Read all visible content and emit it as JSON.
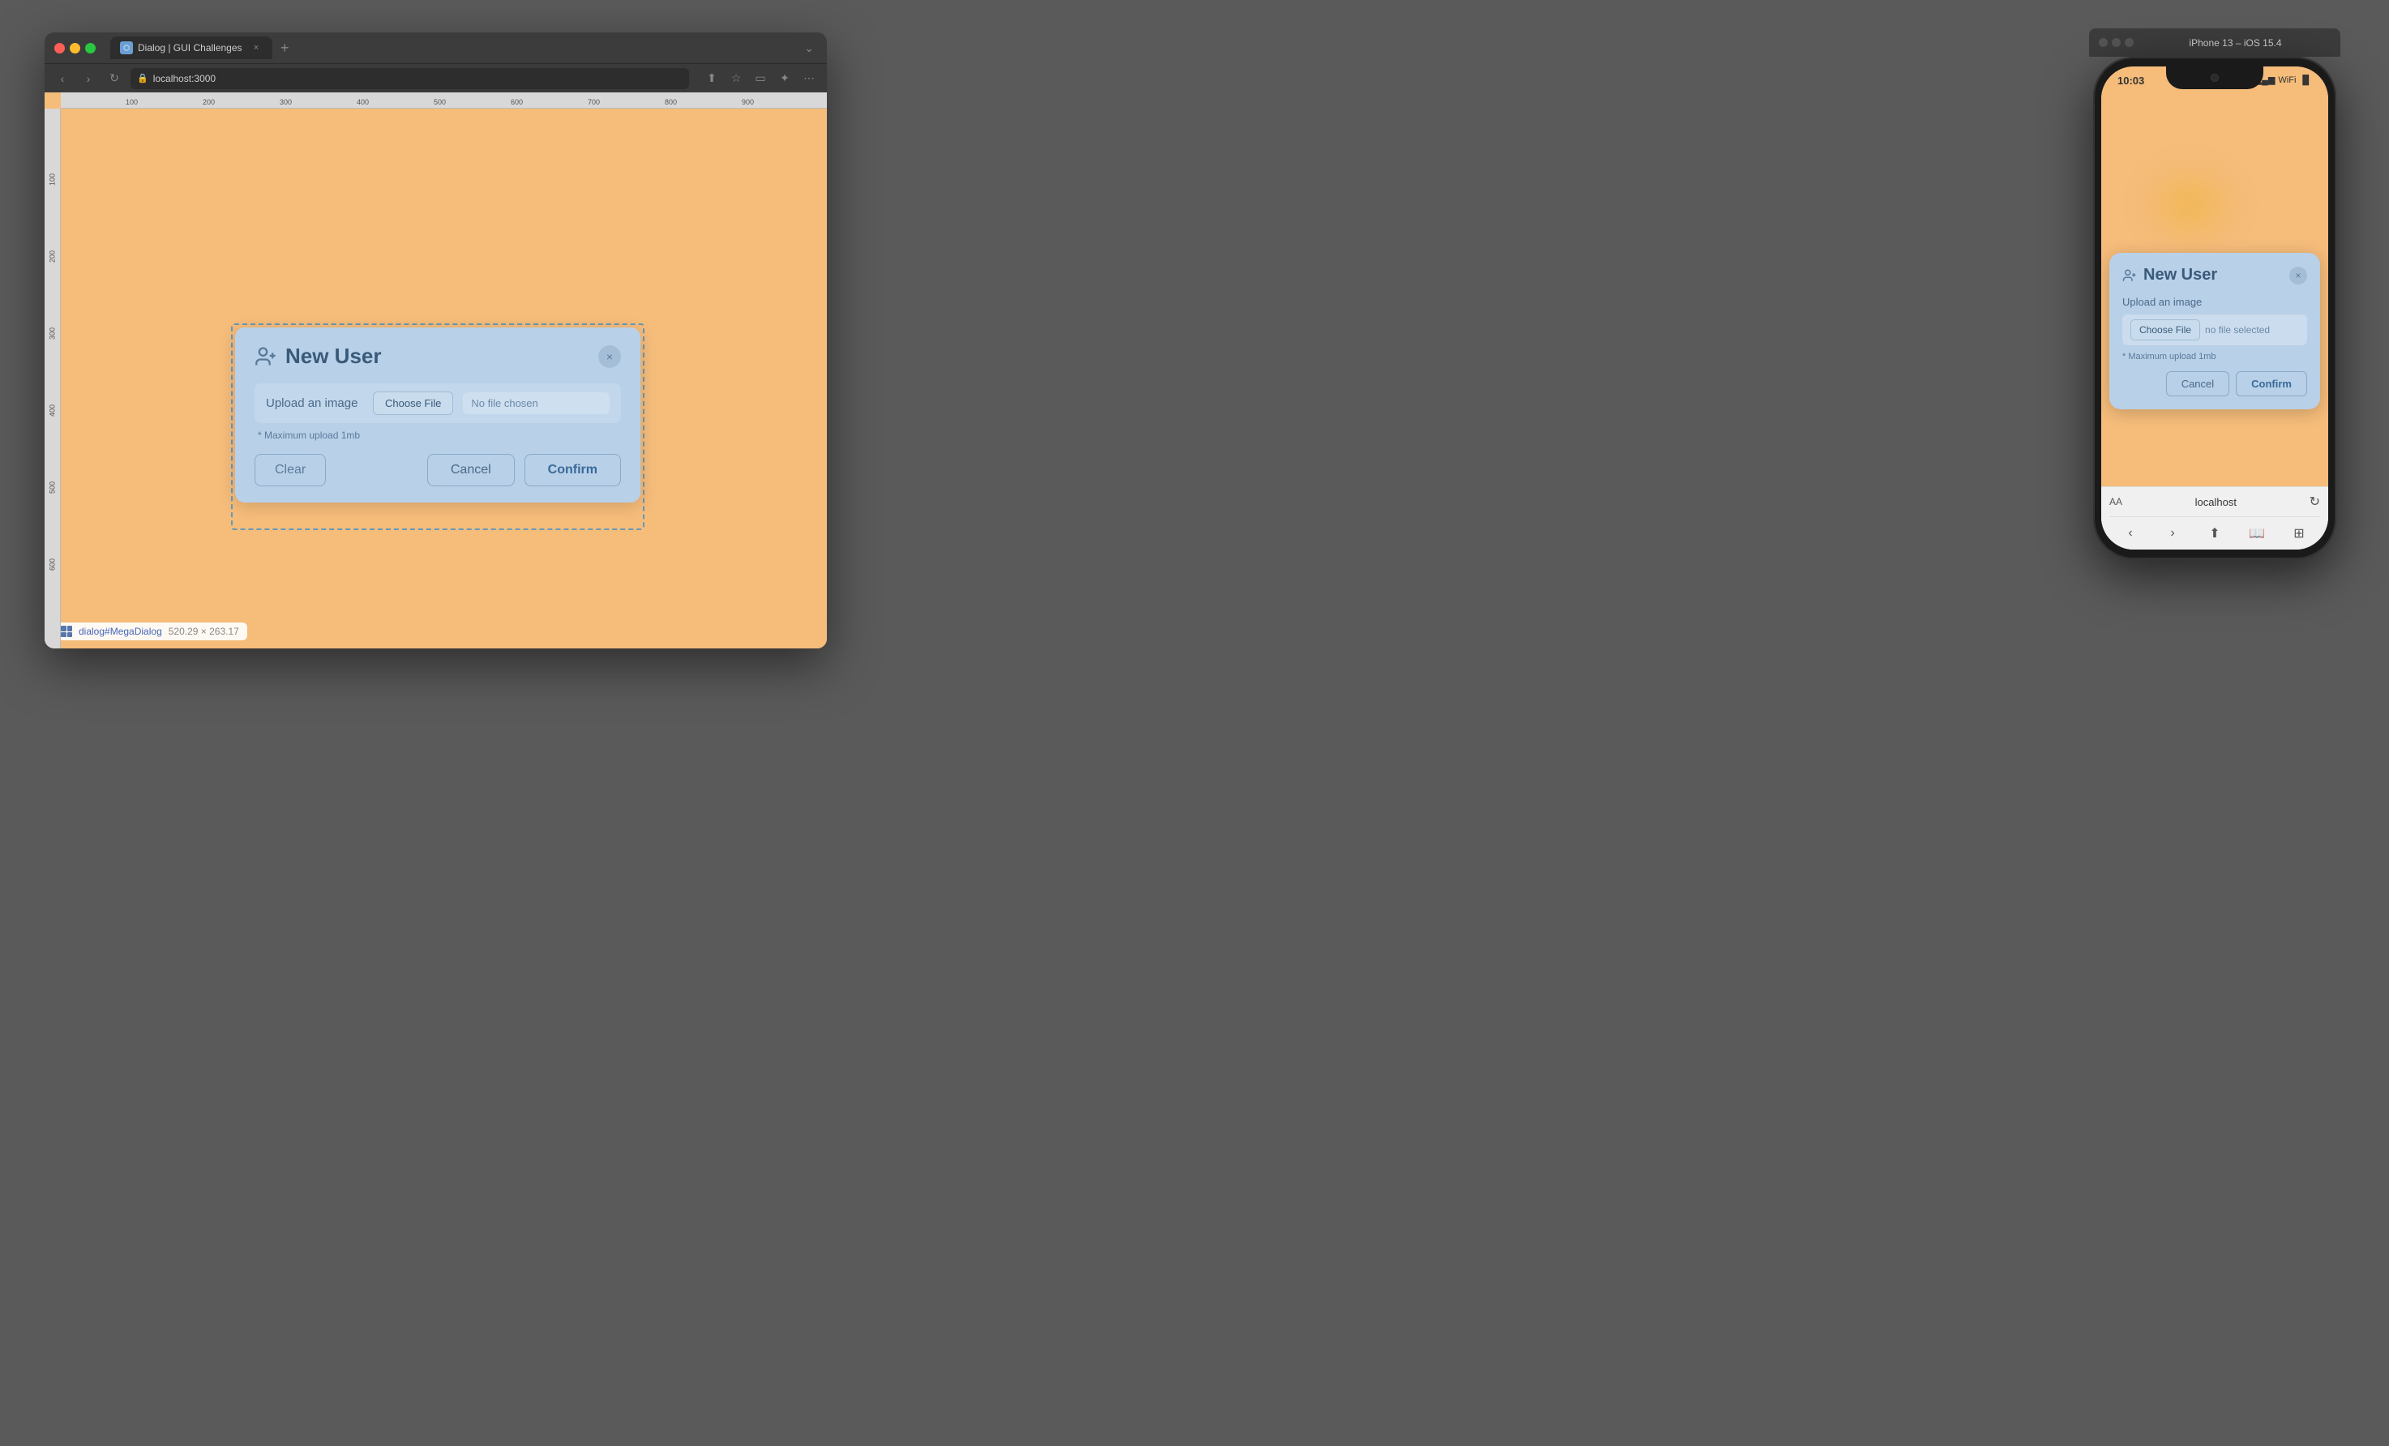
{
  "browser": {
    "tab_title": "Dialog | GUI Challenges",
    "address": "localhost:3000",
    "traffic_lights": [
      "red",
      "yellow",
      "green"
    ],
    "add_tab_label": "+",
    "close_tab_label": "×"
  },
  "dialog": {
    "title": "New User",
    "close_label": "×",
    "upload_label": "Upload an image",
    "choose_file_label": "Choose File",
    "no_file_label": "No file chosen",
    "hint": "* Maximum upload 1mb",
    "clear_label": "Clear",
    "cancel_label": "Cancel",
    "confirm_label": "Confirm",
    "size_info": "520.29 × 263.17",
    "dialog_id": "dialog#MegaDialog"
  },
  "mobile": {
    "window_title": "iPhone 13 – iOS 15.4",
    "status_time": "10:03",
    "status_signal": "▂▄▆",
    "status_wifi": "WiFi",
    "status_battery": "🔋",
    "dialog_title": "New User",
    "close_label": "×",
    "upload_label": "Upload an image",
    "choose_file_label": "Choose File",
    "no_file_label": "no file selected",
    "hint": "* Maximum upload 1mb",
    "cancel_label": "Cancel",
    "confirm_label": "Confirm",
    "address_text": "localhost",
    "aa_label": "AA"
  },
  "ruler": {
    "top_marks": [
      "100",
      "200",
      "300",
      "400",
      "500",
      "600",
      "700",
      "800",
      "900"
    ],
    "left_marks": [
      "100",
      "200",
      "300",
      "400",
      "500",
      "600"
    ]
  },
  "icons": {
    "back": "‹",
    "forward": "›",
    "refresh": "↻",
    "share": "⬆",
    "bookmark": "☆",
    "grid": "⊞",
    "extensions": "🧩",
    "more": "⋯"
  }
}
